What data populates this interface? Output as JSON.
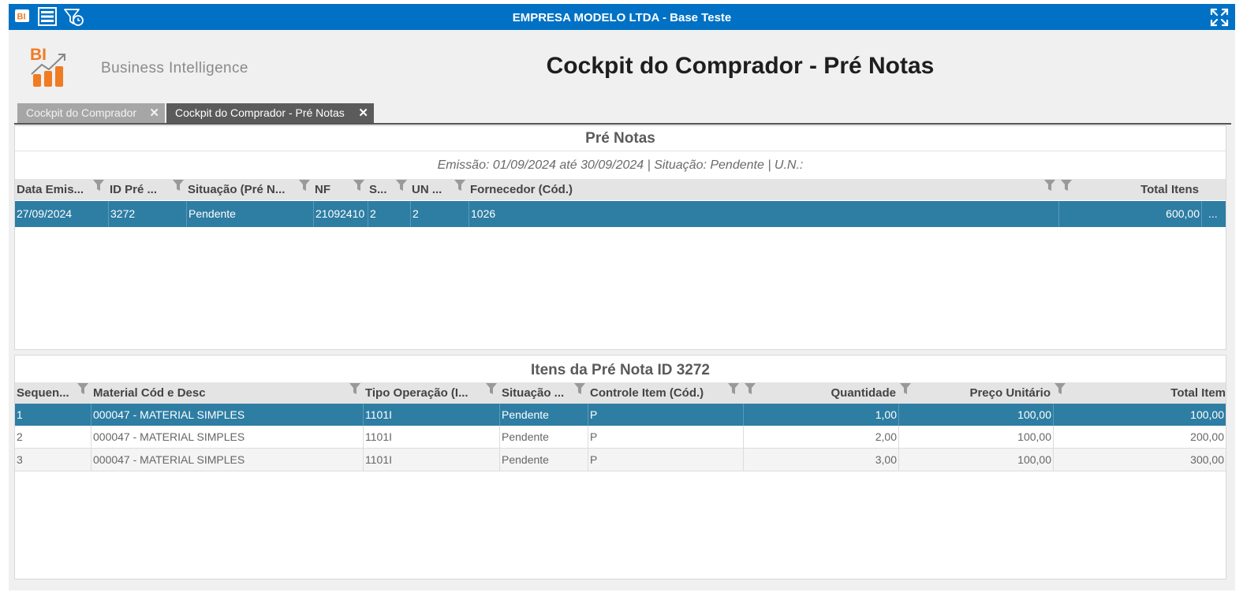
{
  "window": {
    "title": "EMPRESA MODELO LTDA - Base Teste",
    "icons": [
      "bi-icon",
      "list-icon",
      "filter-clock-icon",
      "fullscreen-icon"
    ],
    "accent": "#0071c5"
  },
  "header": {
    "logo_text": "BI",
    "brand": "Business Intelligence",
    "page_title": "Cockpit do Comprador - Pré Notas"
  },
  "tabs": [
    {
      "label": "Cockpit do Comprador",
      "close": "✕"
    },
    {
      "label": "Cockpit do Comprador - Pré Notas",
      "close": "✕"
    }
  ],
  "pre_notas": {
    "title": "Pré Notas",
    "subtitle": "Emissão: 01/09/2024 até 30/09/2024 | Situação: Pendente | U.N.:",
    "columns": [
      "Data Emis...",
      "ID Pré ...",
      "Situação (Pré N...",
      "NF",
      "S...",
      "UN ...",
      "Fornecedor (Cód.)",
      "Total Itens"
    ],
    "rows": [
      {
        "data": "27/09/2024",
        "id": "3272",
        "situacao": "Pendente",
        "nf": "21092410",
        "s": "2",
        "un": "2",
        "fornecedor": "1026",
        "total": "600,00",
        "more": "..."
      }
    ],
    "selected_color": "#2e7da3"
  },
  "itens": {
    "title": "Itens da Pré Nota ID 3272",
    "columns": [
      "Sequen...",
      "Material Cód e Desc",
      "Tipo Operação (I...",
      "Situação ...",
      "Controle Item (Cód.)",
      "Quantidade",
      "Preço Unitário",
      "Total Item"
    ],
    "rows": [
      {
        "seq": "1",
        "material": "000047 - MATERIAL SIMPLES",
        "tipo": "1101I",
        "situacao": "Pendente",
        "controle": "P",
        "qtd": "1,00",
        "preco": "100,00",
        "total": "100,00"
      },
      {
        "seq": "2",
        "material": "000047 - MATERIAL SIMPLES",
        "tipo": "1101I",
        "situacao": "Pendente",
        "controle": "P",
        "qtd": "2,00",
        "preco": "100,00",
        "total": "200,00"
      },
      {
        "seq": "3",
        "material": "000047 - MATERIAL SIMPLES",
        "tipo": "1101I",
        "situacao": "Pendente",
        "controle": "P",
        "qtd": "3,00",
        "preco": "100,00",
        "total": "300,00"
      }
    ]
  }
}
